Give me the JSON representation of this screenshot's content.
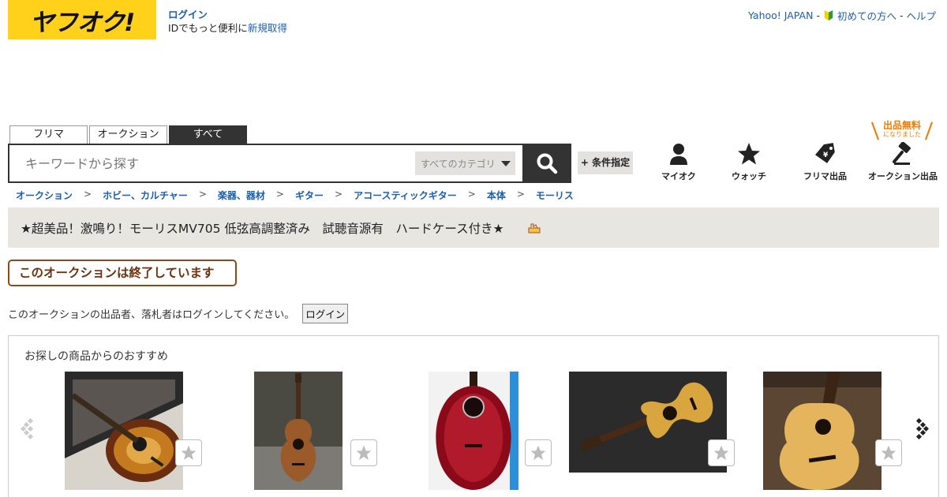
{
  "header": {
    "logo_text": "ヤフオク!",
    "login_label": "ログイン",
    "id_prompt": "IDでもっと便利に",
    "register_label": "新規取得",
    "top_links": [
      "Yahoo! JAPAN",
      "初めての方へ",
      "ヘルプ"
    ],
    "separator": "-"
  },
  "search": {
    "tabs": [
      {
        "label": "フリマ",
        "active": false
      },
      {
        "label": "オークション",
        "active": false
      },
      {
        "label": "すべて",
        "active": true
      }
    ],
    "placeholder": "キーワードから探す",
    "category_label": "すべてのカテゴリ",
    "condition_label": "+ 条件指定"
  },
  "free_badge": {
    "main": "出品無料",
    "sub": "になりました"
  },
  "quick_nav": [
    {
      "label": "マイオク",
      "icon": "person-icon"
    },
    {
      "label": "ウォッチ",
      "icon": "star-icon"
    },
    {
      "label": "フリマ出品",
      "icon": "price-tag-icon"
    },
    {
      "label": "オークション出品",
      "icon": "gavel-icon"
    }
  ],
  "breadcrumb": [
    "オークション",
    "ホビー、カルチャー",
    "楽器、器材",
    "ギター",
    "アコースティックギター",
    "本体",
    "モーリス"
  ],
  "item": {
    "title": "★超美品！激鳴り！モーリスMV705 低弦高調整済み　試聴音源有　ハードケース付き★"
  },
  "status": {
    "ended_label": "このオークションは終了しています",
    "login_notice": "このオークションの出品者、落札者はログインしてください。",
    "login_button": "ログイン"
  },
  "recommend": {
    "heading": "お探しの商品からのおすすめ",
    "items": [
      {
        "image": "sunburst-acoustic-guitar-in-case"
      },
      {
        "image": "brown-acoustic-guitar-standing"
      },
      {
        "image": "red-ovation-style-guitar"
      },
      {
        "image": "natural-dreadnought-guitar-lying"
      },
      {
        "image": "natural-dreadnought-guitar-closeup"
      }
    ]
  },
  "colors": {
    "brand_yellow": "#ffd11a",
    "link_blue": "#1a5eb0",
    "ended_brown": "#8a4b1a",
    "free_orange": "#f07a00"
  }
}
